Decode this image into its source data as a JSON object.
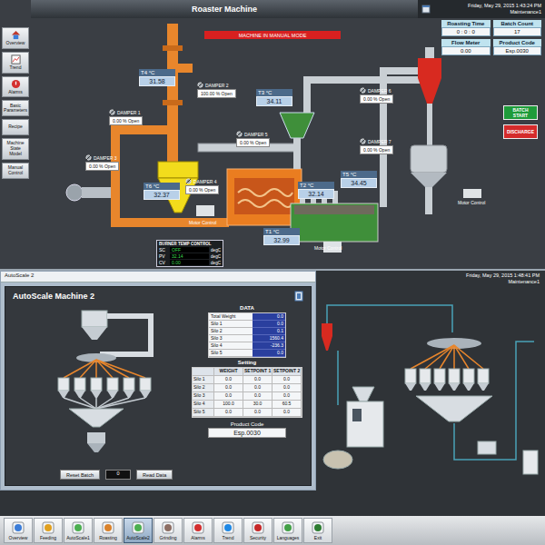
{
  "roaster": {
    "title": "Roaster Machine",
    "datetime": "Friday, May 29, 2015 1:43:24 PM",
    "user": "Maintenance1",
    "banner": "MACHINE IN MANUAL MODE",
    "sidebar": [
      "Overview",
      "Trend",
      "Alarms",
      "Basic Parameters",
      "Recipe",
      "Machine State Model",
      "Manual Control"
    ],
    "info": [
      {
        "label": "Roasting Time",
        "value": "0 : 0 : 0"
      },
      {
        "label": "Batch Count",
        "value": "17"
      },
      {
        "label": "Flow Meter",
        "value": "0.00"
      },
      {
        "label": "Product Code",
        "value": "Esp.0030"
      }
    ],
    "actions": [
      {
        "label": "BATCH START",
        "color": "#1e9b3a"
      },
      {
        "label": "DISCHARGE",
        "color": "#d42b2b"
      }
    ],
    "temperatures": [
      {
        "label": "T4 °C",
        "value": "31.58"
      },
      {
        "label": "T3 °C",
        "value": "34.11"
      },
      {
        "label": "T6 °C",
        "value": "32.37"
      },
      {
        "label": "T2 °C",
        "value": "32.14"
      },
      {
        "label": "T1 °C",
        "value": "32.99"
      },
      {
        "label": "T5 °C",
        "value": "34.45"
      }
    ],
    "dampers": [
      {
        "label": "DAMPER 1",
        "value": "0.00 % Open"
      },
      {
        "label": "DAMPER 2",
        "value": "100.00 % Open"
      },
      {
        "label": "DAMPER 3",
        "value": "0.00 % Open"
      },
      {
        "label": "DAMPER 4",
        "value": "0.00 % Open"
      },
      {
        "label": "DAMPER 5",
        "value": "0.00 % Open"
      },
      {
        "label": "DAMPER 6",
        "value": "0.00 % Open"
      },
      {
        "label": "DAMPER 7",
        "value": "0.00 % Open"
      }
    ],
    "motors": [
      "Motor Control",
      "Motor Control",
      "Motor Control"
    ],
    "burner": {
      "title": "BURNER TEMP CONTROL",
      "unit": "degC",
      "rows": [
        {
          "label": "SC",
          "value": "OFF"
        },
        {
          "label": "PV",
          "value": "32.14"
        },
        {
          "label": "CV",
          "value": "0.00"
        }
      ]
    }
  },
  "autoscale": {
    "tab": "AutoScale 2",
    "title": "AutoScale Machine 2",
    "data_title": "DATA",
    "data_rows": [
      {
        "label": "Total Weight",
        "value": "0.0"
      },
      {
        "label": "Silo 1",
        "value": "0.0"
      },
      {
        "label": "Silo 2",
        "value": "0.1"
      },
      {
        "label": "Silo 3",
        "value": "1560.4"
      },
      {
        "label": "Silo 4",
        "value": "-236.3"
      },
      {
        "label": "Silo 5",
        "value": "0.0"
      }
    ],
    "setting_title": "Setting",
    "setting_columns": [
      "WEIGHT",
      "SETPOINT 1",
      "SETPOINT 2"
    ],
    "setting_rows": [
      [
        "Silo 1",
        "0.0",
        "0.0",
        "0.0"
      ],
      [
        "Silo 2",
        "0.0",
        "0.0",
        "0.0"
      ],
      [
        "Silo 3",
        "0.0",
        "0.0",
        "0.0"
      ],
      [
        "Silo 4",
        "100.0",
        "30.0",
        "60.5"
      ],
      [
        "Silo 5",
        "0.0",
        "0.0",
        "0.0"
      ]
    ],
    "product_label": "Product Code",
    "product_code": "Esp.0030",
    "buttons": [
      "Reset Batch",
      "Read Data"
    ],
    "counter": "0"
  },
  "grinding": {
    "datetime": "Friday, May 29, 2015 1:48:41 PM",
    "user": "Maintenance1"
  },
  "toolbar": [
    {
      "label": "Overview",
      "selected": false
    },
    {
      "label": "Feeding",
      "selected": false
    },
    {
      "label": "AutoScale1",
      "selected": false
    },
    {
      "label": "Roasting",
      "selected": false
    },
    {
      "label": "AutoScale2",
      "selected": true
    },
    {
      "label": "Grinding",
      "selected": false
    },
    {
      "label": "Alarms",
      "selected": false
    },
    {
      "label": "Trend",
      "selected": false
    },
    {
      "label": "Security",
      "selected": false
    },
    {
      "label": "Languages",
      "selected": false
    },
    {
      "label": "Exit",
      "selected": false
    }
  ]
}
